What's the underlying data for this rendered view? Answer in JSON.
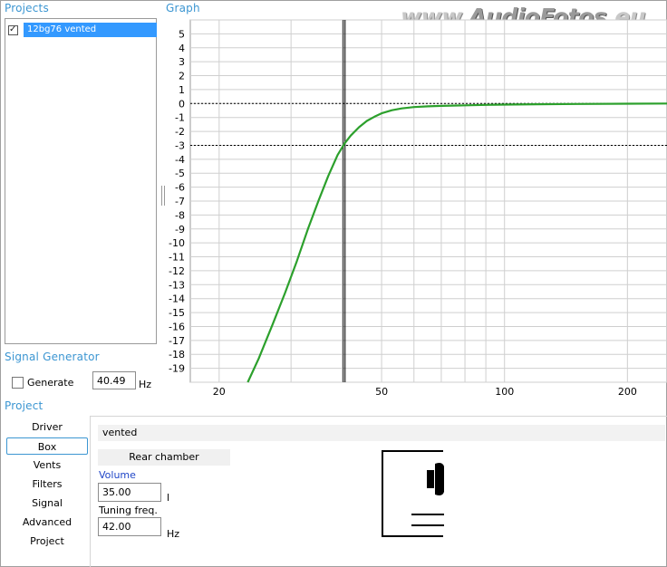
{
  "panels": {
    "projects_title": "Projects",
    "graph_title": "Graph",
    "signal_title": "Signal Generator",
    "project_title": "Project"
  },
  "projects": [
    {
      "name": "12bg76 vented",
      "checked": true
    }
  ],
  "watermark": {
    "prefix": "www.",
    "a": "Audio",
    "b": "Fotos",
    "suffix": ".eu"
  },
  "signal": {
    "generate_label": "Generate",
    "frequency": "40.49",
    "unit": "Hz"
  },
  "nav": [
    "Driver",
    "Box",
    "Vents",
    "Filters",
    "Signal",
    "Advanced",
    "Project"
  ],
  "nav_active": "Box",
  "box": {
    "type": "vented",
    "rear_chamber_label": "Rear chamber",
    "volume_label": "Volume",
    "volume": "35.00",
    "volume_unit": "l",
    "tuning_label": "Tuning freq.",
    "tuning": "42.00",
    "tuning_unit": "Hz"
  },
  "chart_data": {
    "type": "line",
    "title": "",
    "xlabel": "",
    "ylabel": "",
    "x_scale": "log",
    "xlim": [
      17,
      250
    ],
    "ylim": [
      -20,
      6
    ],
    "x_ticks": [
      20,
      50,
      100,
      200
    ],
    "y_ticks": [
      5,
      4,
      3,
      2,
      1,
      0,
      -1,
      -2,
      -3,
      -4,
      -5,
      -6,
      -7,
      -8,
      -9,
      -10,
      -11,
      -12,
      -13,
      -14,
      -15,
      -16,
      -17,
      -18,
      -19
    ],
    "grid": true,
    "reference_lines_y": [
      0,
      -3
    ],
    "cursor_x": 40.49,
    "series": [
      {
        "color": "#2ca02c",
        "x": [
          23.5,
          25,
          27,
          29,
          31,
          33,
          35,
          37,
          39,
          40.5,
          42,
          44,
          46,
          48,
          50,
          53,
          56,
          60,
          65,
          70,
          80,
          90,
          100,
          120,
          150,
          200,
          250
        ],
        "y": [
          -20,
          -18.3,
          -15.9,
          -13.6,
          -11.3,
          -9.0,
          -7.0,
          -5.2,
          -3.7,
          -2.9,
          -2.3,
          -1.7,
          -1.25,
          -0.95,
          -0.7,
          -0.48,
          -0.35,
          -0.25,
          -0.2,
          -0.17,
          -0.13,
          -0.1,
          -0.08,
          -0.05,
          -0.03,
          -0.01,
          0
        ]
      }
    ]
  }
}
